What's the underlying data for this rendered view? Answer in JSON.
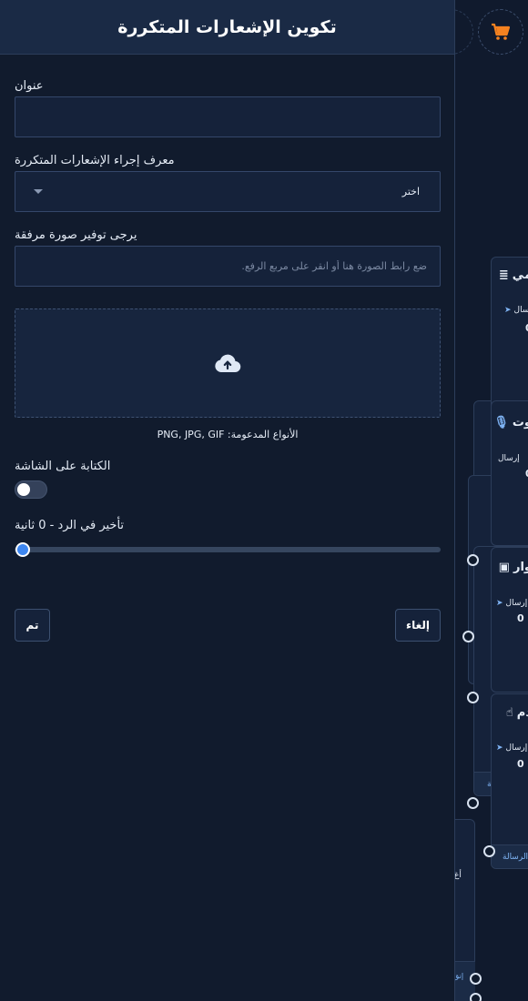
{
  "panel": {
    "title": "تكوين الإشعارات المتكررة",
    "title_field": {
      "label": "عنوان",
      "value": "",
      "placeholder": ""
    },
    "action_id_field": {
      "label": "معرف إجراء الإشعارات المتكررة",
      "selected": "اختر"
    },
    "image_field": {
      "label": "يرجى توفير صورة مرفقة",
      "placeholder": "ضع رابط الصورة هنا أو انقر على مربع الرفع."
    },
    "dropzone": {
      "icon": "cloud-upload-icon",
      "supported_types": "الأنواع المدعومة: PNG, JPG, GIF"
    },
    "typing_toggle": {
      "label": "الكتابة على الشاشة",
      "enabled": false
    },
    "response_delay": {
      "label": "تأخير في الرد  -  0 ثانية",
      "value_seconds": 0
    },
    "buttons": {
      "done": "تم",
      "cancel": "إلغاء"
    }
  },
  "canvas": {
    "cart_icon": "cart-icon",
    "nodes": [
      {
        "title": "مي",
        "icon": "list-icon",
        "send_label": "رسال",
        "count": "0"
      },
      {
        "title": "وت",
        "icon": "mic-icon",
        "send_label": "إرسال",
        "count": "0"
      },
      {
        "title": "وار",
        "icon": "image-icon",
        "send_label": "إرسال",
        "count": "0"
      },
      {
        "title": "دم",
        "icon": "hand-icon",
        "send_label": "إرسال",
        "count": "0",
        "footer": "الرسالة"
      }
    ],
    "partial_labels": {
      "left_footer": "الة",
      "bottom_a": "أغ",
      "bottom_b": "إنق",
      "bottom_c": "أغ"
    }
  },
  "colors": {
    "accent": "#3d86f0",
    "cart": "#f58220",
    "panel_bg": "#111b2d",
    "header_bg": "#1a2a45"
  }
}
